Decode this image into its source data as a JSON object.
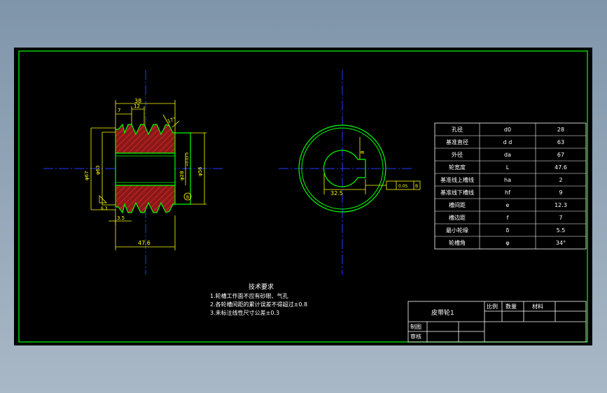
{
  "drawing": {
    "part_name": "皮带轮1",
    "notes": {
      "title": "技术要求",
      "items": [
        "1.轮槽工作面不应有砂眼、气孔",
        "2.各轮槽间距的累计误差不得超过±0.8",
        "3.未标注线性尺寸公差±0.3"
      ]
    },
    "dimensions": {
      "top_width": "38",
      "groove_pitch": "12",
      "groove_edge": "7",
      "outer_dia": "φ67",
      "pitch_dia": "φ63",
      "bore_dia": "φ28",
      "bore_tol": "+0.03 0",
      "hub_dia": "φ56",
      "bottom_offset": "3.5",
      "total_width": "47.6",
      "groove_angle": "17°",
      "keyway_depth": "32.5",
      "keyway_width": "8",
      "tolerance_value": "0.05",
      "datum": "B",
      "surface_mark": "6.3"
    },
    "params_table": [
      {
        "name": "孔径",
        "symbol": "d0",
        "value": "28"
      },
      {
        "name": "基准直径",
        "symbol": "d d",
        "value": "63"
      },
      {
        "name": "外径",
        "symbol": "da",
        "value": "67"
      },
      {
        "name": "轮宽度",
        "symbol": "L",
        "value": "47.6"
      },
      {
        "name": "基准线上槽线",
        "symbol": "ha",
        "value": "2"
      },
      {
        "name": "基准线下槽线",
        "symbol": "hf",
        "value": "9"
      },
      {
        "name": "槽间距",
        "symbol": "e",
        "value": "12.3"
      },
      {
        "name": "槽边距",
        "symbol": "f",
        "value": "7"
      },
      {
        "name": "最小轮缘",
        "symbol": "δ",
        "value": "5.5"
      },
      {
        "name": "轮槽角",
        "symbol": "φ",
        "value": "34°"
      }
    ],
    "title_block": {
      "scale_label": "比例",
      "qty_label": "数量",
      "material_label": "材料",
      "drawn_label": "制图",
      "checked_label": "审核"
    },
    "colors": {
      "border": "#00ff00",
      "object": "#00ff00",
      "center": "#1f3cff",
      "dimension": "#ffff00",
      "hatch": "#ff3030",
      "text": "#ffffff",
      "section_fill": "#8a1818"
    }
  }
}
